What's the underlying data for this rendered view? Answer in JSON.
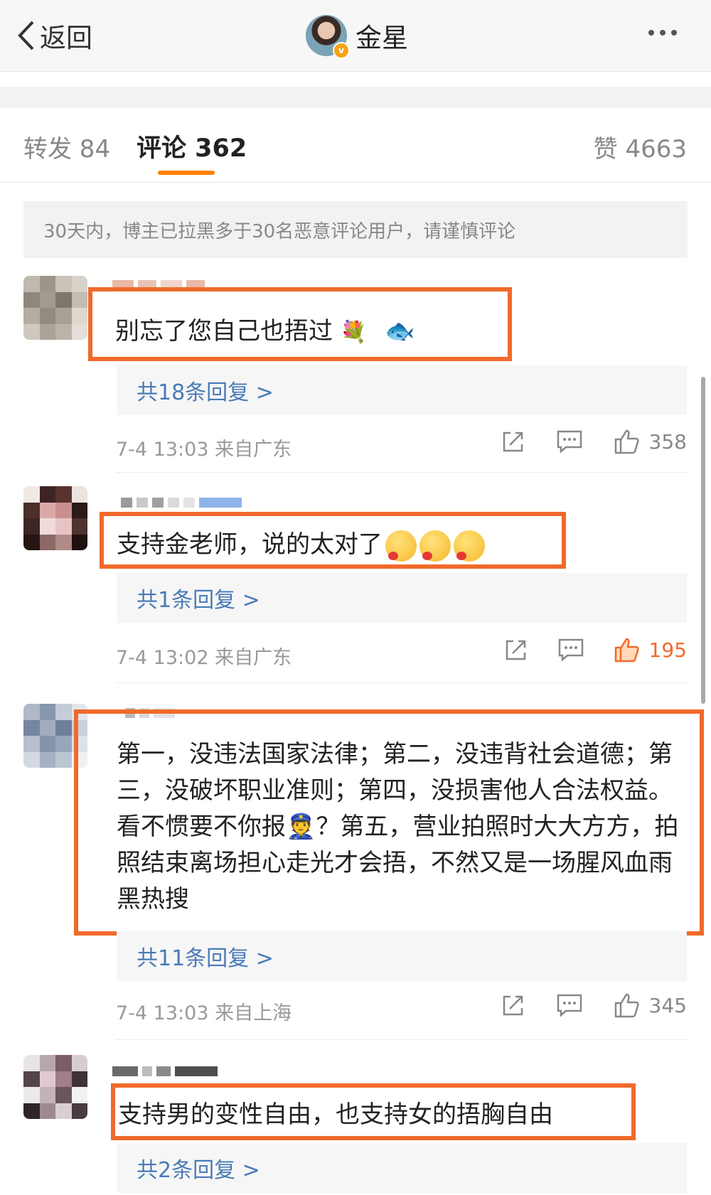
{
  "header": {
    "back_label": "返回",
    "author_name": "金星",
    "verified_mark": "v"
  },
  "tabs": {
    "repost": "转发 84",
    "comments": "评论 362",
    "likes": "赞 4663"
  },
  "notice": "30天内，博主已拉黑多于30名恶意评论用户，请谨慎评论",
  "comments": [
    {
      "text": "别忘了您自己也捂过",
      "replies": "共18条回复 >",
      "meta": "7-4 13:03 来自广东",
      "likes": "358",
      "liked": false
    },
    {
      "text": "支持金老师，说的太对了",
      "replies": "共1条回复 >",
      "meta": "7-4 13:02 来自广东",
      "likes": "195",
      "liked": true
    },
    {
      "text": "第一，没违法国家法律；第二，没违背社会道德；第三，没破坏职业准则；第四，没损害他人合法权益。看不惯要不你报👮？第五，营业拍照时大大方方，拍照结束离场担心走光才会捂，不然又是一场腥风血雨黑热搜",
      "replies": "共11条回复 >",
      "meta": "7-4 13:03 来自上海",
      "likes": "345",
      "liked": false
    },
    {
      "text": "支持男的变性自由，也支持女的捂胸自由",
      "replies": "共2条回复 >"
    }
  ],
  "colors": {
    "accent": "#ff8200",
    "highlight_box": "#f06a2c",
    "link": "#4a7ab8"
  }
}
